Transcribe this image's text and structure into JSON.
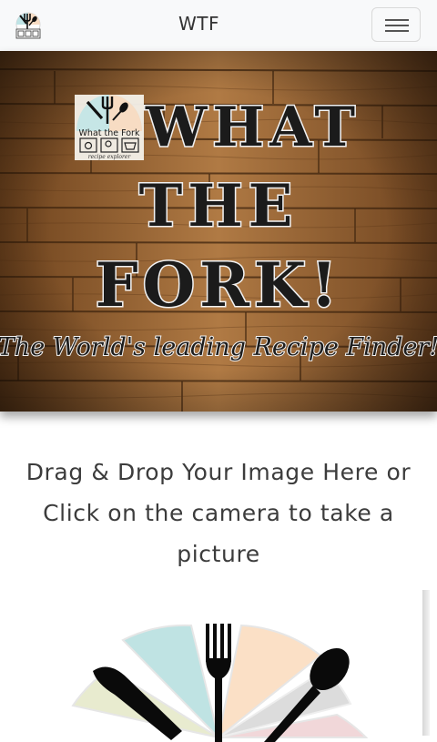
{
  "navbar": {
    "brand_text": "WTF",
    "logo_icon": "what-the-fork-logo",
    "menu_icon": "hamburger-menu-icon"
  },
  "hero": {
    "logo_title": "What the Fork",
    "logo_subtitle": "recipe explorer",
    "title_lines": [
      "WHAT",
      "THE",
      "FORK!"
    ],
    "tagline": "The World's leading Recipe Finder!"
  },
  "upload": {
    "prompt": "Drag & Drop Your Image Here or Click on the camera to take a picture",
    "camera_icon": "plate-with-cutlery-icon"
  },
  "colors": {
    "navbar_bg": "#f8f9fa",
    "wood": "#8a5a2e",
    "text": "#3c3c3c"
  }
}
